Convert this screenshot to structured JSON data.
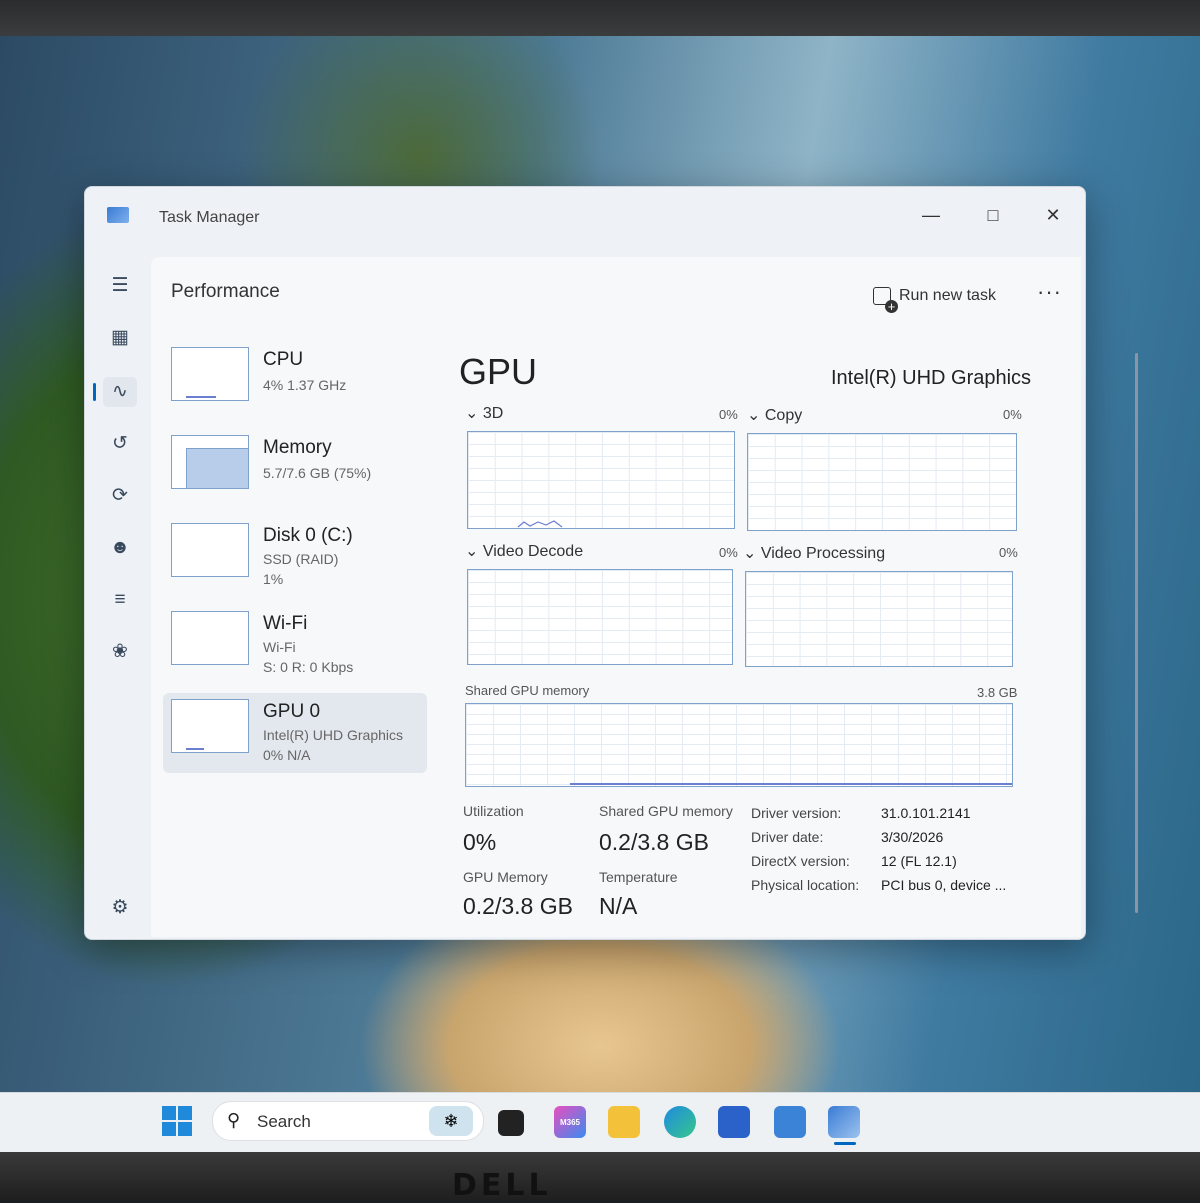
{
  "window": {
    "title": "Task Manager"
  },
  "header": {
    "page_title": "Performance",
    "run_new_task": "Run new task",
    "more": "···"
  },
  "resources": [
    {
      "name": "CPU",
      "line1": "4% 1.37 GHz",
      "line2": ""
    },
    {
      "name": "Memory",
      "line1": "5.7/7.6 GB (75%)",
      "line2": ""
    },
    {
      "name": "Disk 0 (C:)",
      "line1": "SSD (RAID)",
      "line2": "1%"
    },
    {
      "name": "Wi-Fi",
      "line1": "Wi-Fi",
      "line2": "S: 0 R: 0 Kbps"
    },
    {
      "name": "GPU 0",
      "line1": "Intel(R) UHD Graphics",
      "line2": "0% N/A"
    }
  ],
  "gpu": {
    "title": "GPU",
    "model": "Intel(R) UHD Graphics",
    "engines": [
      {
        "name": "3D",
        "pct": "0%"
      },
      {
        "name": "Copy",
        "pct": "0%"
      },
      {
        "name": "Video Decode",
        "pct": "0%"
      },
      {
        "name": "Video Processing",
        "pct": "0%"
      }
    ],
    "shared_memory": {
      "label": "Shared GPU memory",
      "max": "3.8 GB"
    },
    "stats": {
      "utilization_label": "Utilization",
      "utilization": "0%",
      "shared_label": "Shared GPU memory",
      "shared": "0.2/3.8 GB",
      "gpu_memory_label": "GPU Memory",
      "gpu_memory": "0.2/3.8 GB",
      "temperature_label": "Temperature",
      "temperature": "N/A"
    },
    "info": [
      {
        "key": "Driver version:",
        "value": "31.0.101.2141"
      },
      {
        "key": "Driver date:",
        "value": "3/30/2026"
      },
      {
        "key": "DirectX version:",
        "value": "12 (FL 12.1)"
      },
      {
        "key": "Physical location:",
        "value": "PCI bus 0, device ..."
      }
    ]
  },
  "taskbar": {
    "search_label": "Search",
    "copilot_badge": "M365"
  },
  "laptop_brand": "DELL"
}
